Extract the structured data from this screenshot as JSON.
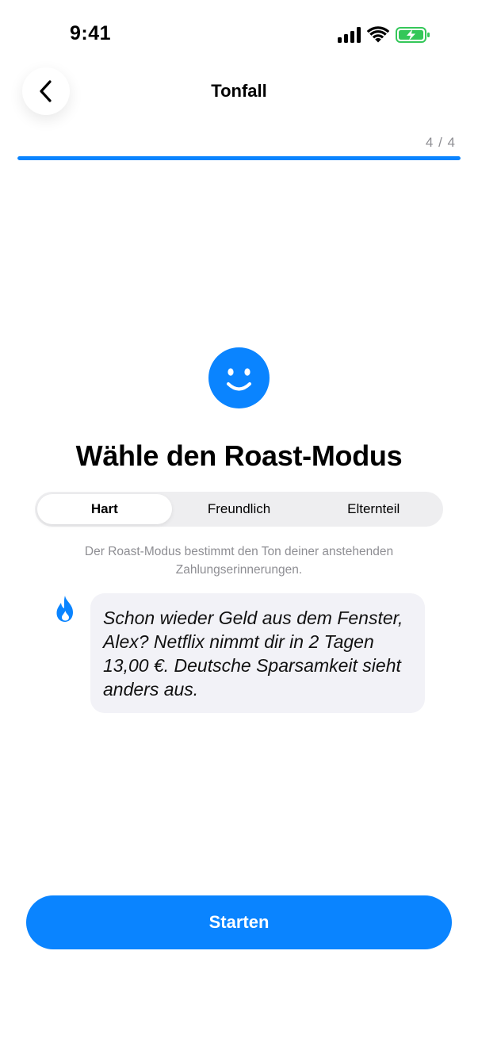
{
  "status_bar": {
    "time": "9:41"
  },
  "nav": {
    "title": "Tonfall"
  },
  "progress": {
    "label": "4 / 4",
    "fraction": 1.0
  },
  "colors": {
    "accent": "#0a84ff",
    "battery": "#34c759"
  },
  "icons": {
    "back": "chevron-left-icon",
    "hero": "smiley-icon",
    "flame": "flame-icon"
  },
  "main": {
    "heading": "Wähle den Roast-Modus",
    "segments": [
      {
        "label": "Hart",
        "active": true
      },
      {
        "label": "Freundlich",
        "active": false
      },
      {
        "label": "Elternteil",
        "active": false
      }
    ],
    "description": "Der Roast-Modus bestimmt den Ton deiner anstehenden Zahlungserinnerungen.",
    "preview": "Schon wieder Geld aus dem Fenster, Alex? Netflix nimmt dir in 2 Tagen 13,00 €. Deutsche Sparsamkeit sieht anders aus."
  },
  "footer": {
    "start_label": "Starten"
  }
}
